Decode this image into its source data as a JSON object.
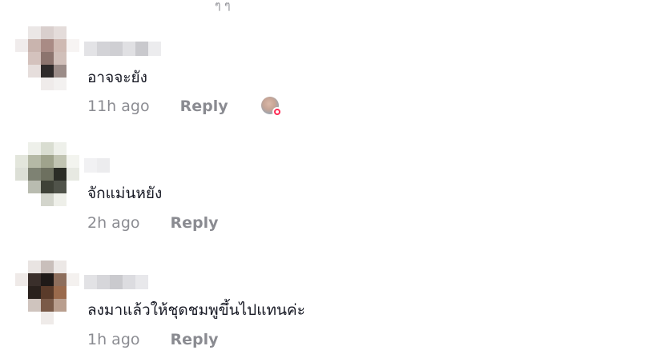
{
  "top_fragment": "ๆ ๆ",
  "comments": [
    {
      "text": "อาจจะยัง",
      "time": "11h ago",
      "reply": "Reply"
    },
    {
      "text": "จักแม่นหยัง",
      "time": "2h ago",
      "reply": "Reply"
    },
    {
      "text": "ลงมาแล้วให้ชุดชมพูขึ้นไปแทนค่ะ",
      "time": "1h ago",
      "reply": "Reply"
    }
  ],
  "colors": {
    "background": "#ffffff",
    "text": "#161823",
    "muted": "rgba(22,24,35,0.5)",
    "like_badge": "#fe2c55"
  }
}
